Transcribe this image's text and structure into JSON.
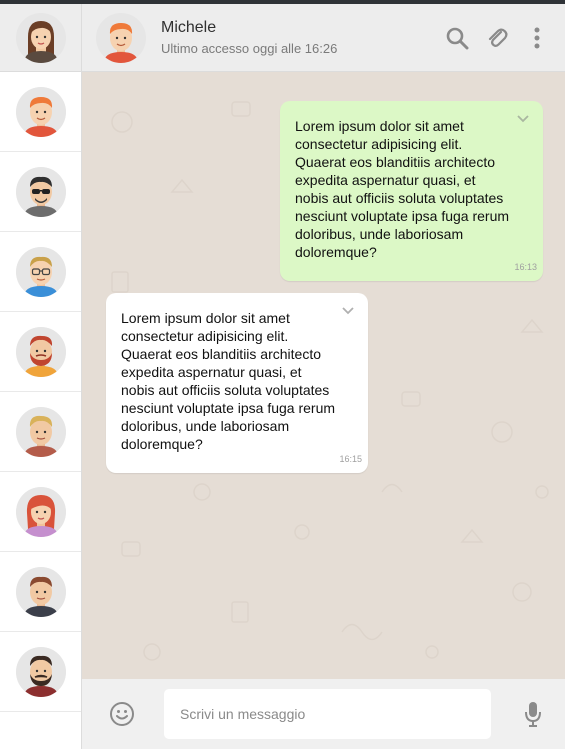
{
  "header": {
    "contact_name": "Michele",
    "last_seen": "Ultimo accesso oggi alle 16:26"
  },
  "sidebar": {
    "contacts": [
      {
        "avatar": "avatar-ginger-man"
      },
      {
        "avatar": "avatar-sunglasses-man"
      },
      {
        "avatar": "avatar-glasses-man"
      },
      {
        "avatar": "avatar-bearded-man"
      },
      {
        "avatar": "avatar-blond-man"
      },
      {
        "avatar": "avatar-red-hair-woman"
      },
      {
        "avatar": "avatar-brown-hair-man"
      },
      {
        "avatar": "avatar-mustache-man"
      }
    ]
  },
  "messages": [
    {
      "type": "sent",
      "text": "Lorem ipsum dolor sit amet consectetur adipisicing elit. Quaerat eos blanditiis architecto expedita aspernatur quasi, et nobis aut officiis soluta voluptates nesciunt voluptate ipsa fuga rerum doloribus, unde laboriosam doloremque?",
      "time": "16:13"
    },
    {
      "type": "received",
      "text": "Lorem ipsum dolor sit amet consectetur adipisicing elit. Quaerat eos blanditiis architecto expedita aspernatur quasi, et nobis aut officiis soluta voluptates nesciunt voluptate ipsa fuga rerum doloribus, unde laboriosam doloremque?",
      "time": "16:15"
    }
  ],
  "composer": {
    "placeholder": "Scrivi un messaggio"
  },
  "colors": {
    "sent_bubble": "#dcf8c6",
    "received_bubble": "#ffffff",
    "chat_background": "#e5ddd5",
    "header_background": "#ededed"
  }
}
